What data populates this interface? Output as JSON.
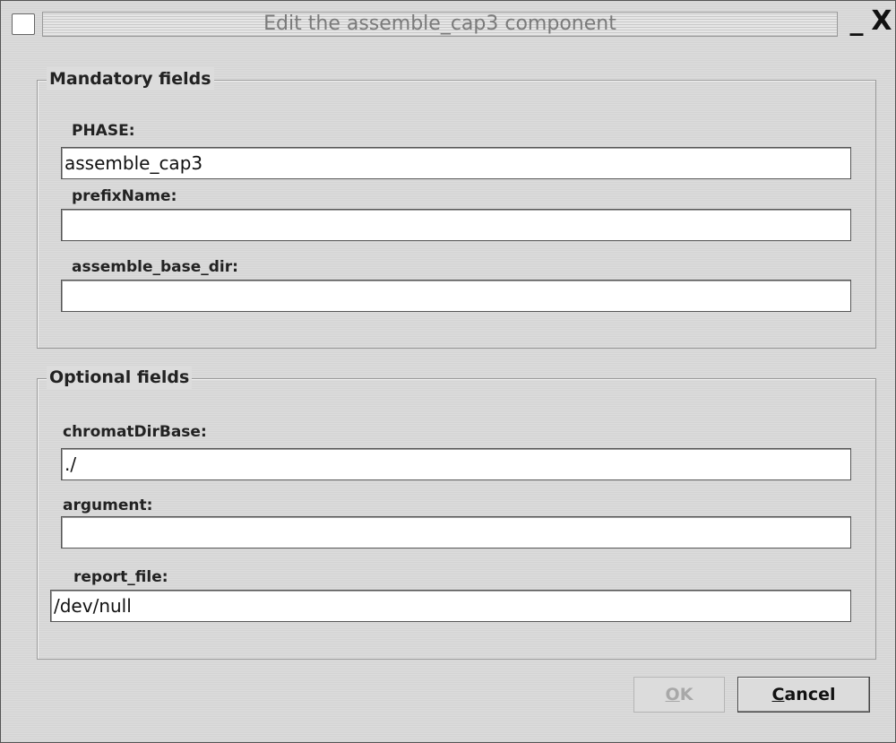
{
  "window": {
    "title": "Edit the assemble_cap3 component",
    "minimize_glyph": "_",
    "close_glyph": "X"
  },
  "mandatory": {
    "legend": "Mandatory fields",
    "fields": [
      {
        "label": "PHASE:",
        "value": "assemble_cap3"
      },
      {
        "label": "prefixName:",
        "value": ""
      },
      {
        "label": "assemble_base_dir:",
        "value": ""
      }
    ]
  },
  "optional": {
    "legend": "Optional fields",
    "fields": [
      {
        "label": "chromatDirBase:",
        "value": "./"
      },
      {
        "label": "argument:",
        "value": ""
      },
      {
        "label": "report_file:",
        "value": "/dev/null"
      }
    ]
  },
  "buttons": {
    "ok_mnemonic": "O",
    "ok_rest": "K",
    "cancel_mnemonic": "C",
    "cancel_rest": "ancel"
  }
}
